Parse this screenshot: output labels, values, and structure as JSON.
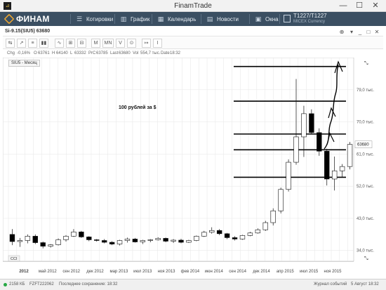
{
  "window": {
    "title": "FinamTrade",
    "minimize": "—",
    "maximize": "☐",
    "close": "✕"
  },
  "menu": {
    "logo": "ФИНАМ",
    "items": [
      {
        "label": "Котировки",
        "icon": "quotes-icon"
      },
      {
        "label": "График",
        "icon": "chart-icon"
      },
      {
        "label": "Календарь",
        "icon": "calendar-icon"
      },
      {
        "label": "Новости",
        "icon": "news-icon"
      },
      {
        "label": "Окна",
        "icon": "windows-icon"
      }
    ],
    "instrument": {
      "name": "T1227/T1227",
      "sub": "MICEX Currency"
    }
  },
  "panel": {
    "title": "Si-9.15(SIU5) 63680"
  },
  "toolbar": {
    "buttons": [
      "⇆",
      "↗",
      "≡",
      "▮▮",
      "∿",
      "⊞",
      "⊟",
      "M",
      "MN",
      "V",
      "⊙",
      "↦",
      "I"
    ]
  },
  "infobar": {
    "chg_label": "Chg",
    "chg": "-0,16%",
    "o_label": "O",
    "o": "63761",
    "h_label": "H",
    "h": "64140",
    "l_label": "L",
    "l": "63332",
    "prc_label": "PrC",
    "prc": "63785",
    "last_label": "Last",
    "last": "63680",
    "vol_label": "Vol",
    "vol": "554,7 тыс.",
    "date_label": "Date",
    "date": "18:32"
  },
  "series_label": "SIU5 - Месяц",
  "indicator_tag": "CCI",
  "statusbar": {
    "size": "2158 КБ",
    "account": "FZFT222062",
    "saved": "Последнее сохранение: 18:32",
    "journal": "Журнал событий",
    "datetime": "5 Август 18:32"
  },
  "chart_data": {
    "type": "candlestick",
    "title": "",
    "annotation": "100 рублей за $",
    "current_price_label": "63680",
    "current_price": 63680,
    "y_ticks": [
      {
        "label": "34,0 тыс.",
        "value": 34000
      },
      {
        "label": "43,0 тыс.",
        "value": 43000
      },
      {
        "label": "52,0 тыс.",
        "value": 52000
      },
      {
        "label": "61,0 тыс.",
        "value": 61000
      },
      {
        "label": "70,0 тыс.",
        "value": 70000
      },
      {
        "label": "79,0 тыс.",
        "value": 79000
      }
    ],
    "ylim": [
      31000,
      88000
    ],
    "x_ticks": [
      "2012",
      "май 2012",
      "сен 2012",
      "дек 2012",
      "мар 2013",
      "июл 2013",
      "ноя 2013",
      "фев 2014",
      "июн 2014",
      "сен 2014",
      "дек 2014",
      "апр 2015",
      "июл 2015",
      "ноя 2015"
    ],
    "candles": [
      [
        38500,
        40000,
        35500,
        36500
      ],
      [
        36500,
        37500,
        35000,
        36800
      ],
      [
        36800,
        38500,
        36000,
        38000
      ],
      [
        38000,
        38500,
        35800,
        36200
      ],
      [
        36200,
        36500,
        34600,
        35200
      ],
      [
        35200,
        35800,
        34800,
        35600
      ],
      [
        35600,
        37400,
        35400,
        37000
      ],
      [
        37000,
        38300,
        36500,
        38000
      ],
      [
        38000,
        40000,
        37800,
        39200
      ],
      [
        39200,
        39500,
        37500,
        37800
      ],
      [
        37800,
        38000,
        36600,
        37000
      ],
      [
        37000,
        37200,
        36500,
        36800
      ],
      [
        36800,
        37200,
        36000,
        36300
      ],
      [
        36300,
        36600,
        35500,
        35800
      ],
      [
        35800,
        37000,
        35400,
        36800
      ],
      [
        36800,
        37600,
        36200,
        37200
      ],
      [
        37200,
        37500,
        36200,
        36400
      ],
      [
        36400,
        37000,
        35800,
        36800
      ],
      [
        36800,
        37200,
        36300,
        37000
      ],
      [
        37000,
        37700,
        36800,
        37400
      ],
      [
        37400,
        37600,
        36300,
        36600
      ],
      [
        36600,
        37200,
        36100,
        36900
      ],
      [
        36900,
        37300,
        36000,
        36300
      ],
      [
        36300,
        37000,
        36100,
        36800
      ],
      [
        36800,
        38200,
        36600,
        38000
      ],
      [
        38000,
        39500,
        37800,
        39100
      ],
      [
        39100,
        40500,
        38700,
        39600
      ],
      [
        39600,
        40000,
        38300,
        38700
      ],
      [
        38700,
        38900,
        37200,
        37600
      ],
      [
        37600,
        38000,
        36800,
        37200
      ],
      [
        37200,
        38400,
        37000,
        38200
      ],
      [
        38200,
        39200,
        38000,
        38900
      ],
      [
        38900,
        40200,
        38700,
        39800
      ],
      [
        39800,
        42300,
        39500,
        41800
      ],
      [
        41800,
        45800,
        41000,
        45100
      ],
      [
        45100,
        51600,
        44400,
        51100
      ],
      [
        51100,
        59500,
        50500,
        58700
      ],
      [
        58700,
        82000,
        58000,
        65800
      ],
      [
        65800,
        74500,
        60200,
        72300
      ],
      [
        72300,
        73500,
        66500,
        67000
      ],
      [
        67000,
        68200,
        60500,
        61800
      ],
      [
        61800,
        62500,
        52200,
        54000
      ],
      [
        54000,
        60300,
        50800,
        56300
      ],
      [
        56300,
        58200,
        54600,
        57500
      ],
      [
        57500,
        64400,
        56700,
        63700
      ]
    ],
    "levels": [
      54500,
      62200,
      66600,
      75800,
      85500
    ],
    "hand_drawn_arrow": true
  }
}
